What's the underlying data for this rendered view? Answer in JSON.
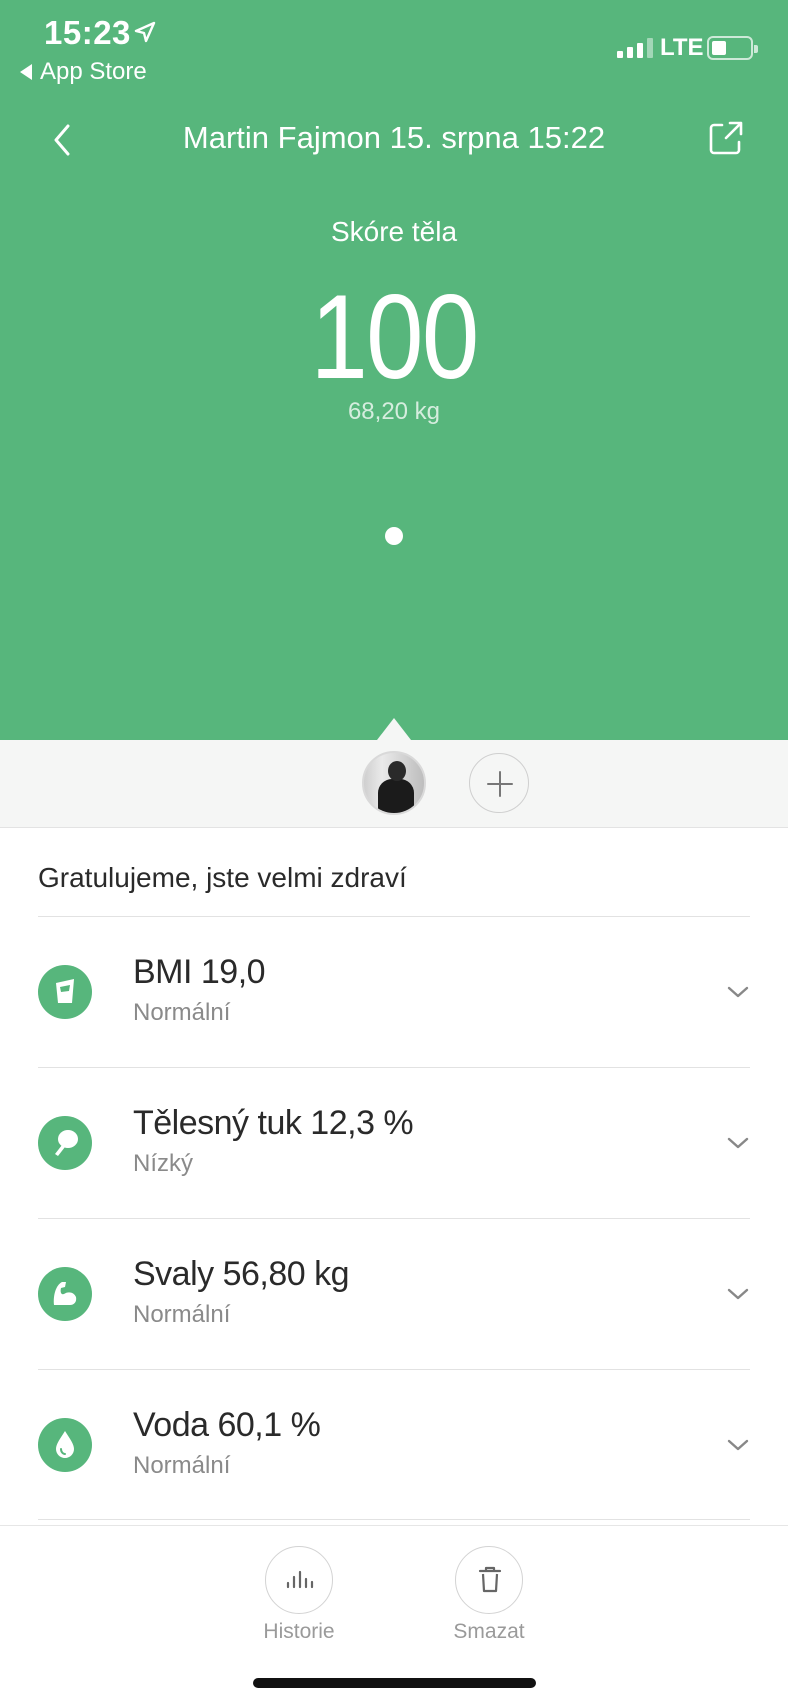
{
  "status_bar": {
    "time": "15:23",
    "back_app": "App Store",
    "network": "LTE",
    "battery_level": 0.25,
    "signal_bars": 3
  },
  "nav": {
    "title": "Martin Fajmon 15. srpna 15:22"
  },
  "score": {
    "label": "Skóre těla",
    "value": "100",
    "weight": "68,20 kg"
  },
  "summary": "Gratulujeme, jste velmi zdraví",
  "metrics": [
    {
      "title": "BMI 19,0",
      "status": "Normální",
      "icon": "bmi-icon"
    },
    {
      "title": "Tělesný tuk 12,3 %",
      "status": "Nízký",
      "icon": "body-fat-icon"
    },
    {
      "title": "Svaly 56,80 kg",
      "status": "Normální",
      "icon": "muscle-icon"
    },
    {
      "title": "Voda 60,1 %",
      "status": "Normální",
      "icon": "water-drop-icon"
    }
  ],
  "toolbar": {
    "history_label": "Historie",
    "delete_label": "Smazat"
  },
  "colors": {
    "accent": "#57b67c",
    "background": "#ffffff",
    "strip": "#f5f6f5"
  }
}
